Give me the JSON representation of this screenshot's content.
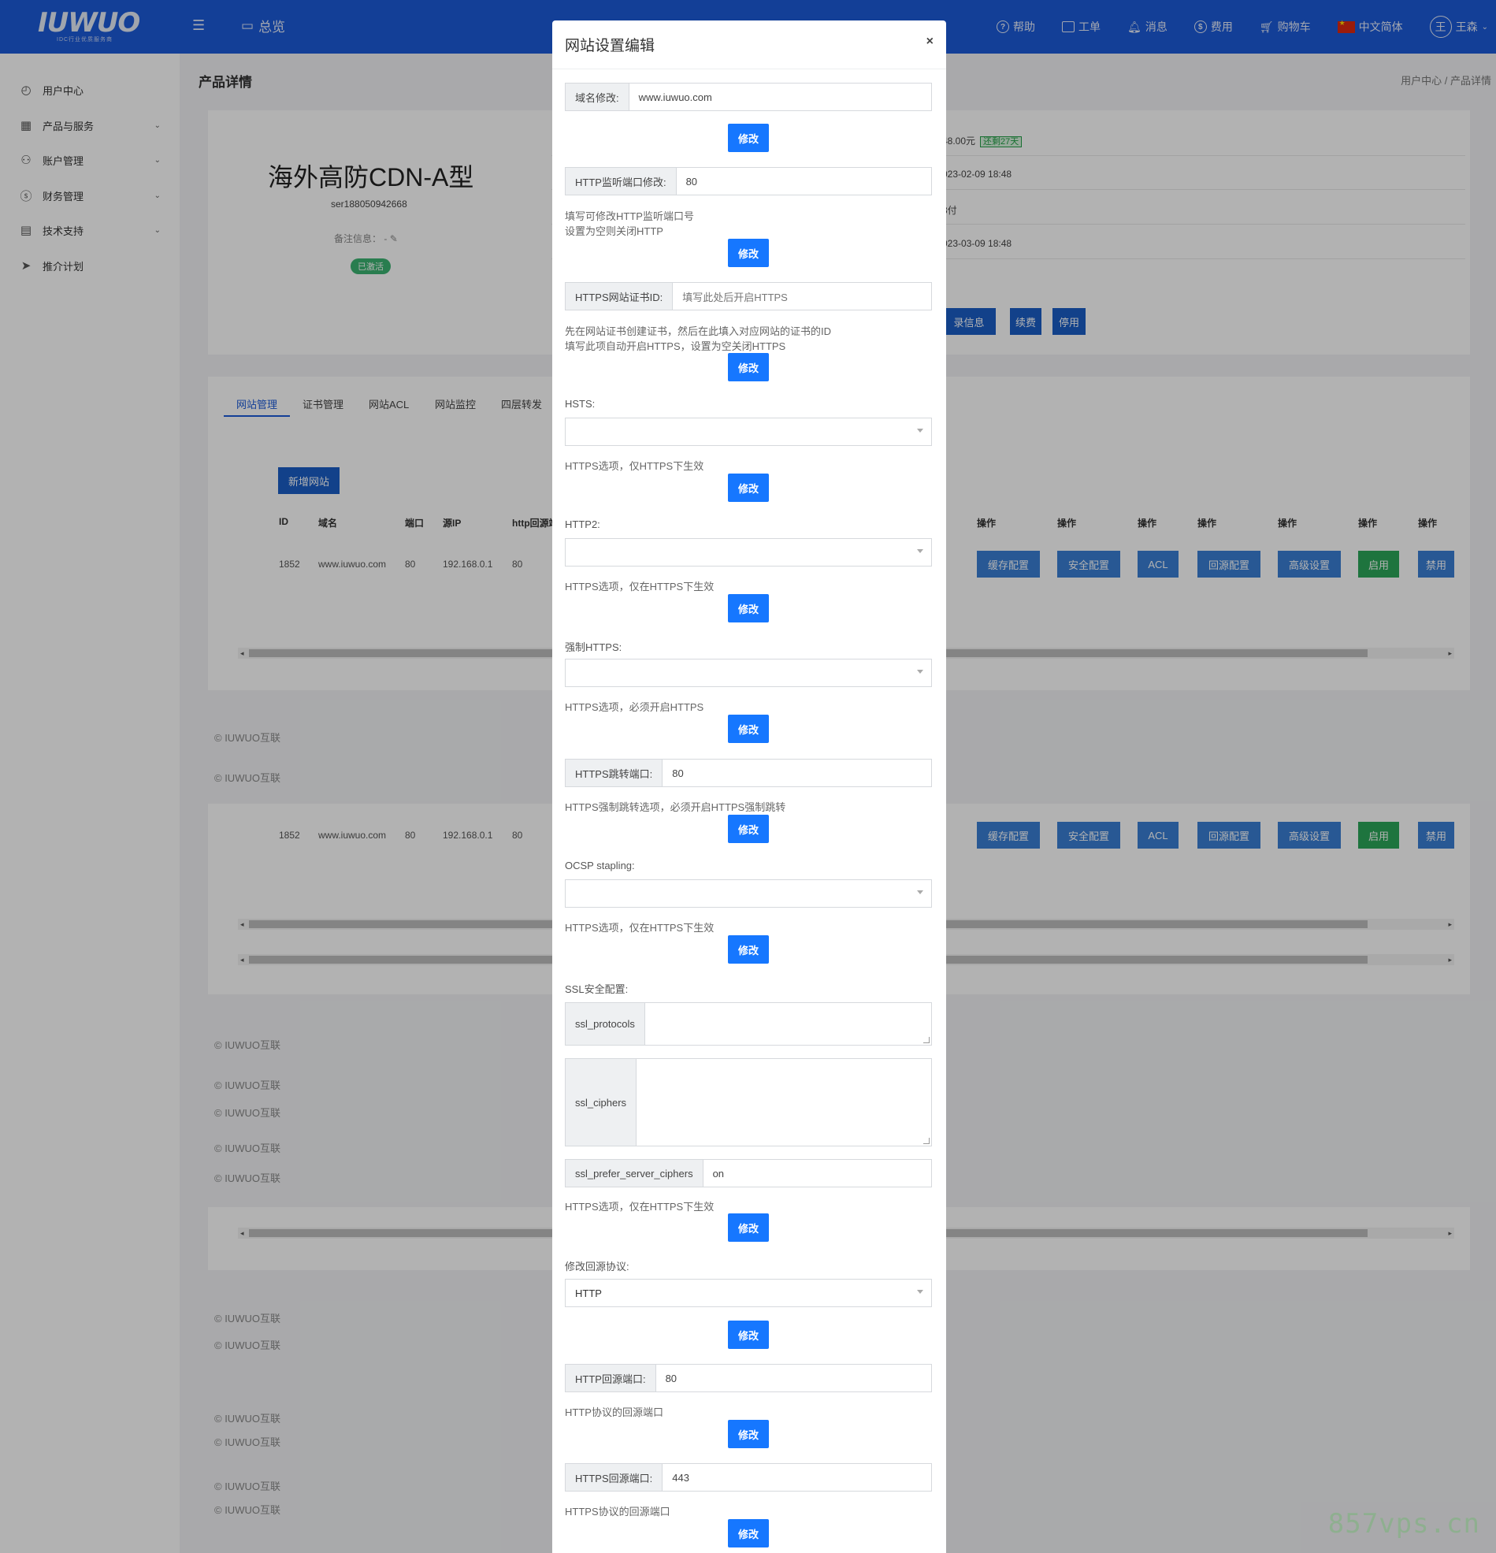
{
  "topbar": {
    "logo_text": "IUWUO",
    "logo_sub": "IDC行业优质服务商",
    "overview": "总览",
    "help": "帮助",
    "ticket": "工单",
    "message": "消息",
    "cost": "费用",
    "cart": "购物车",
    "lang": "中文简体",
    "user_initial": "王",
    "user_name": "王森"
  },
  "sidebar": {
    "items": [
      {
        "label": "用户中心",
        "icon": "dashboard-icon"
      },
      {
        "label": "产品与服务",
        "icon": "grid-icon"
      },
      {
        "label": "账户管理",
        "icon": "user-icon"
      },
      {
        "label": "财务管理",
        "icon": "dollar-icon"
      },
      {
        "label": "技术支持",
        "icon": "list-icon"
      },
      {
        "label": "推介计划",
        "icon": "send-icon"
      }
    ]
  },
  "page": {
    "title": "产品详情",
    "breadcrumb_home": "用户中心",
    "breadcrumb_sep": "/",
    "breadcrumb_current": "产品详情",
    "product_name": "海外高防CDN-A型",
    "product_id": "ser188050942668",
    "note_label": "备注信息：",
    "note_value": "-",
    "status": "已激活",
    "price": "48.00元",
    "remaining": "还剩27天",
    "created": "023-02-09 18:48",
    "pay_type": "3付",
    "due": "023-03-09 18:48",
    "btn_info": "录信息",
    "btn_renew": "续费",
    "btn_stop": "停用",
    "tabs": [
      "网站管理",
      "证书管理",
      "网站ACL",
      "网站监控",
      "四层转发"
    ],
    "add_site": "新增网站",
    "columns": [
      "ID",
      "域名",
      "端口",
      "源IP",
      "http回源端"
    ],
    "op_header": "操作",
    "row": {
      "id": "1852",
      "domain": "www.iuwuo.com",
      "port": "80",
      "src_ip": "192.168.0.1",
      "http_port": "80"
    },
    "ops": [
      "缓存配置",
      "安全配置",
      "ACL",
      "回源配置",
      "高级设置",
      "启用",
      "禁用"
    ],
    "footer": "© IUWUO互联"
  },
  "modal": {
    "title": "网站设置编辑",
    "close": "×",
    "domain_label": "域名修改:",
    "domain_value": "www.iuwuo.com",
    "submit": "修改",
    "http_port_label": "HTTP监听端口修改:",
    "http_port_value": "80",
    "http_port_help1": "填写可修改HTTP监听端口号",
    "http_port_help2": "设置为空则关闭HTTP",
    "cert_label": "HTTPS网站证书ID:",
    "cert_placeholder": "填写此处后开启HTTPS",
    "cert_help1": "先在网站证书创建证书，然后在此填入对应网站的证书的ID",
    "cert_help2": "填写此项自动开启HTTPS，设置为空关闭HTTPS",
    "hsts_label": "HSTS:",
    "hsts_help": "HTTPS选项，仅HTTPS下生效",
    "http2_label": "HTTP2:",
    "http2_help": "HTTPS选项，仅在HTTPS下生效",
    "force_label": "强制HTTPS:",
    "force_help": "HTTPS选项，必须开启HTTPS",
    "jump_label": "HTTPS跳转端口:",
    "jump_value": "80",
    "jump_help": "HTTPS强制跳转选项，必须开启HTTPS强制跳转",
    "ocsp_label": "OCSP stapling:",
    "ocsp_help": "HTTPS选项，仅在HTTPS下生效",
    "ssl_label": "SSL安全配置:",
    "ssl_protocols_label": "ssl_protocols",
    "ssl_ciphers_label": "ssl_ciphers",
    "ssl_prefer_label": "ssl_prefer_server_ciphers",
    "ssl_prefer_value": "on",
    "ssl_help": "HTTPS选项，仅在HTTPS下生效",
    "origin_proto_label": "修改回源协议:",
    "origin_proto_value": "HTTP",
    "http_origin_label": "HTTP回源端口:",
    "http_origin_value": "80",
    "http_origin_help": "HTTP协议的回源端口",
    "https_origin_label": "HTTPS回源端口:",
    "https_origin_value": "443",
    "https_origin_help": "HTTPS协议的回源端口"
  },
  "watermark": "857vps.cn"
}
